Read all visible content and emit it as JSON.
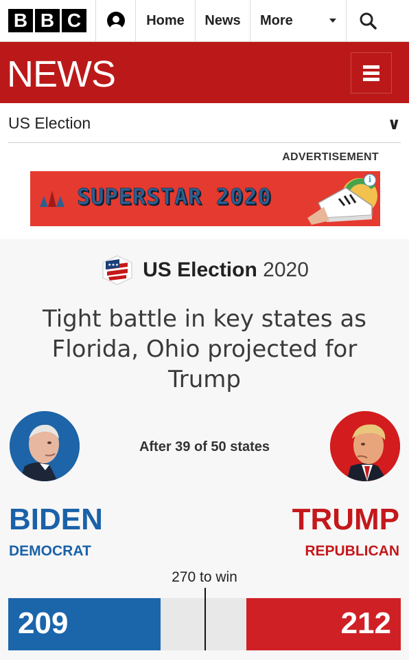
{
  "brand": {
    "bbc_letters": [
      "B",
      "B",
      "C"
    ]
  },
  "nav": {
    "home": "Home",
    "news": "News",
    "more": "More"
  },
  "header": {
    "title": "NEWS"
  },
  "section": {
    "label": "US Election"
  },
  "ad": {
    "label": "ADVERTISEMENT",
    "text": "SUPERSTAR 2020"
  },
  "election": {
    "title_bold": "US Election",
    "title_year": "2020",
    "headline": "Tight battle in key states as Florida, Ohio projected for Trump",
    "progress": "After 39 of 50 states",
    "to_win": "270 to win",
    "total_votes": 538,
    "win_threshold": 270,
    "candidates": {
      "dem": {
        "name": "BIDEN",
        "party": "DEMOCRAT",
        "votes": 209,
        "color": "#1b65ab"
      },
      "rep": {
        "name": "TRUMP",
        "party": "REPUBLICAN",
        "votes": 212,
        "color": "#cf2026"
      }
    }
  },
  "colors": {
    "news_red": "#bb1919",
    "panel_bg": "#f7f7f7"
  }
}
